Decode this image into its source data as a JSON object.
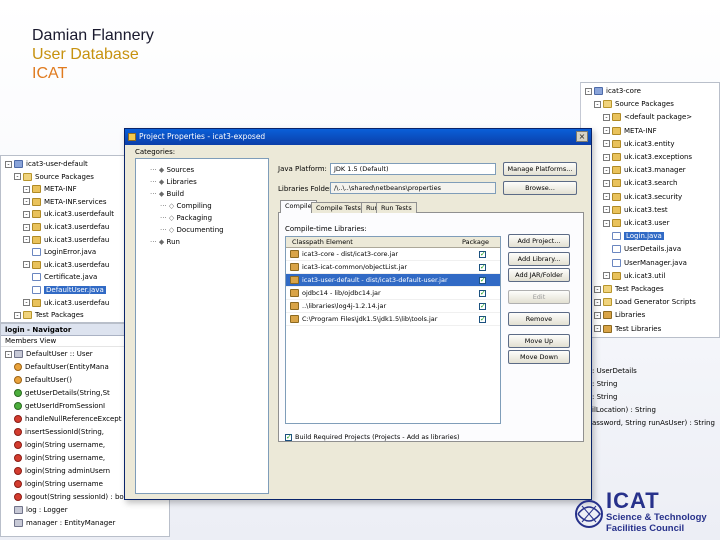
{
  "slide": {
    "line1": "Damian Flannery",
    "line2": "User Database",
    "line3": "ICAT"
  },
  "colors": {
    "dialog_title_bar": "#0b3ea8",
    "selection": "#316ac5",
    "logo_blue": "#27318b",
    "header_gold": "#c7920f",
    "header_orange": "#e07b1f"
  },
  "right_tree": {
    "items": [
      {
        "label": "icat3-core",
        "icon": "project-icon"
      },
      {
        "label": "Source Packages",
        "icon": "package-folder-icon"
      },
      {
        "label": "<default package>",
        "icon": "package-icon"
      },
      {
        "label": "META-INF",
        "icon": "package-icon"
      },
      {
        "label": "uk.icat3.entity",
        "icon": "package-icon"
      },
      {
        "label": "uk.icat3.exceptions",
        "icon": "package-icon"
      },
      {
        "label": "uk.icat3.manager",
        "icon": "package-icon"
      },
      {
        "label": "uk.icat3.search",
        "icon": "package-icon"
      },
      {
        "label": "uk.icat3.security",
        "icon": "package-icon"
      },
      {
        "label": "uk.icat3.test",
        "icon": "package-icon"
      },
      {
        "label": "uk.icat3.user",
        "icon": "package-icon"
      },
      {
        "label": "Login.java",
        "icon": "java-file-icon"
      },
      {
        "label": "UserDetails.java",
        "icon": "java-file-icon"
      },
      {
        "label": "UserManager.java",
        "icon": "java-file-icon"
      },
      {
        "label": "uk.icat3.util",
        "icon": "package-icon"
      },
      {
        "label": "Test Packages",
        "icon": "package-folder-icon"
      },
      {
        "label": "Load Generator Scripts",
        "icon": "folder-icon"
      },
      {
        "label": "Libraries",
        "icon": "library-icon"
      },
      {
        "label": "Test Libraries",
        "icon": "library-icon"
      }
    ],
    "method_fragments": [
      ": UserDetails",
      ": String",
      ": String",
      "ilLocation) : String",
      "assword, String runAsUser) : String"
    ]
  },
  "left_tree": {
    "items": [
      {
        "label": "icat3-user-default",
        "icon": "project-icon"
      },
      {
        "label": "Source Packages",
        "icon": "package-folder-icon"
      },
      {
        "label": "META-INF",
        "icon": "package-icon"
      },
      {
        "label": "META-INF.services",
        "icon": "package-icon"
      },
      {
        "label": "uk.icat3.userdefault",
        "icon": "package-icon"
      },
      {
        "label": "uk.icat3.userdefau",
        "icon": "package-icon"
      },
      {
        "label": "uk.icat3.userdefau",
        "icon": "package-icon"
      },
      {
        "label": "LoginError.java",
        "icon": "java-file-icon"
      },
      {
        "label": "uk.icat3.userdefau",
        "icon": "package-icon"
      },
      {
        "label": "Certificate.java",
        "icon": "java-file-icon"
      },
      {
        "label": "DefaultUser.java",
        "icon": "java-file-icon"
      },
      {
        "label": "uk.icat3.userdefau",
        "icon": "package-icon"
      },
      {
        "label": "Test Packages",
        "icon": "package-folder-icon"
      }
    ]
  },
  "navigator": {
    "title": "login - Navigator",
    "view": "Members View",
    "items": [
      {
        "label": "DefaultUser :: User",
        "icon": "class-icon"
      },
      {
        "label": "DefaultUser(EntityMana",
        "icon": "method-orange-icon"
      },
      {
        "label": "DefaultUser()",
        "icon": "method-orange-icon"
      },
      {
        "label": "getUserDetails(String,St",
        "icon": "method-green-icon"
      },
      {
        "label": "getUserIdFromSessionI",
        "icon": "method-green-icon"
      },
      {
        "label": "handleNullReferenceExcept",
        "icon": "method-red-icon"
      },
      {
        "label": "insertSessionId(String,",
        "icon": "method-red-icon"
      },
      {
        "label": "login(String username,",
        "icon": "method-red-icon"
      },
      {
        "label": "login(String username,",
        "icon": "method-red-icon"
      },
      {
        "label": "login(String adminUsern",
        "icon": "method-red-icon"
      },
      {
        "label": "login(String username",
        "icon": "method-red-icon"
      },
      {
        "label": "logout(String sessionId) : boolean",
        "icon": "method-red-icon"
      },
      {
        "label": "log : Logger",
        "icon": "field-icon"
      },
      {
        "label": "manager : EntityManager",
        "icon": "field-icon"
      }
    ]
  },
  "dialog": {
    "title": "Project Properties - icat3-exposed",
    "categories_label": "Categories:",
    "categories": [
      {
        "label": "Sources",
        "indent": 1
      },
      {
        "label": "Libraries",
        "indent": 1
      },
      {
        "label": "Build",
        "indent": 1
      },
      {
        "label": "Compiling",
        "indent": 2
      },
      {
        "label": "Packaging",
        "indent": 2
      },
      {
        "label": "Documenting",
        "indent": 2
      },
      {
        "label": "Run",
        "indent": 1
      }
    ],
    "java_platform_label": "Java Platform:",
    "java_platform_value": "JDK 1.5 (Default)",
    "manage_platforms": "Manage Platforms...",
    "libraries_folder_label": "Libraries Folder:",
    "libraries_folder_value": "/\\..\\..\\shared\\netbeans\\properties",
    "browse": "Browse...",
    "tabs": [
      "Compile",
      "Compile Tests",
      "Run",
      "Run Tests"
    ],
    "compile_time_label": "Compile-time Libraries:",
    "table_headers": {
      "name": "Classpath Element",
      "package": "Package"
    },
    "libraries": [
      {
        "label": "icat3-core - dist/icat3-core.jar",
        "package": true,
        "selected": false
      },
      {
        "label": "icat3-icat-common/objectList.jar",
        "package": true,
        "selected": false
      },
      {
        "label": "icat3-user-default - dist/icat3-default-user.jar",
        "package": true,
        "selected": true
      },
      {
        "label": "ojdbc14 - lib/ojdbc14.jar",
        "package": true,
        "selected": false
      },
      {
        "label": "..\\libraries\\log4j-1.2.14.jar",
        "package": true,
        "selected": false
      },
      {
        "label": "C:\\Program Files\\jdk1.5\\jdk1.5\\lib\\tools.jar",
        "package": true,
        "selected": false
      }
    ],
    "buttons": [
      "Add Project...",
      "Add Library...",
      "Add JAR/Folder",
      "Edit",
      "Remove",
      "Move Up",
      "Move Down"
    ],
    "build_projects_label": "Build Required Projects (Projects - Add as libraries)"
  },
  "logo": {
    "line1": "ICAT",
    "line2": "Science & Technology",
    "line3": "Facilities Council"
  }
}
